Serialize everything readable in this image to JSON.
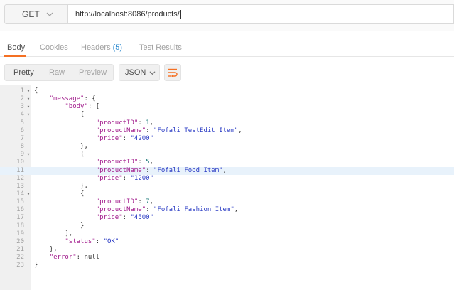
{
  "request": {
    "method": "GET",
    "url": "http://localhost:8086/products/"
  },
  "tabs": [
    {
      "label": "Body"
    },
    {
      "label": "Cookies"
    },
    {
      "label": "Headers"
    },
    {
      "label": "Test Results"
    }
  ],
  "headers_count": "(5)",
  "views": [
    {
      "label": "Pretty"
    },
    {
      "label": "Raw"
    },
    {
      "label": "Preview"
    }
  ],
  "format": "JSON",
  "colors": {
    "accent": "#f47023",
    "key": "#a11a8b",
    "string": "#2a3bc4",
    "number": "#1d7a7a",
    "highlight": "#e8f2fb"
  },
  "code": [
    {
      "n": "1",
      "fold": true,
      "tokens": [
        {
          "t": "p",
          "v": "{"
        }
      ]
    },
    {
      "n": "2",
      "fold": true,
      "tokens": [
        {
          "t": "p",
          "v": "    "
        },
        {
          "t": "k",
          "v": "\"message\""
        },
        {
          "t": "p",
          "v": ": {"
        }
      ]
    },
    {
      "n": "3",
      "fold": true,
      "tokens": [
        {
          "t": "p",
          "v": "        "
        },
        {
          "t": "k",
          "v": "\"body\""
        },
        {
          "t": "p",
          "v": ": ["
        }
      ]
    },
    {
      "n": "4",
      "fold": true,
      "tokens": [
        {
          "t": "p",
          "v": "            {"
        }
      ]
    },
    {
      "n": "5",
      "fold": false,
      "tokens": [
        {
          "t": "p",
          "v": "                "
        },
        {
          "t": "k",
          "v": "\"productID\""
        },
        {
          "t": "p",
          "v": ": "
        },
        {
          "t": "n",
          "v": "1"
        },
        {
          "t": "p",
          "v": ","
        }
      ]
    },
    {
      "n": "6",
      "fold": false,
      "tokens": [
        {
          "t": "p",
          "v": "                "
        },
        {
          "t": "k",
          "v": "\"productName\""
        },
        {
          "t": "p",
          "v": ": "
        },
        {
          "t": "s",
          "v": "\"Fofali TestEdit Item\""
        },
        {
          "t": "p",
          "v": ","
        }
      ]
    },
    {
      "n": "7",
      "fold": false,
      "tokens": [
        {
          "t": "p",
          "v": "                "
        },
        {
          "t": "k",
          "v": "\"price\""
        },
        {
          "t": "p",
          "v": ": "
        },
        {
          "t": "s",
          "v": "\"4200\""
        }
      ]
    },
    {
      "n": "8",
      "fold": false,
      "tokens": [
        {
          "t": "p",
          "v": "            },"
        }
      ]
    },
    {
      "n": "9",
      "fold": true,
      "tokens": [
        {
          "t": "p",
          "v": "            {"
        }
      ]
    },
    {
      "n": "10",
      "fold": false,
      "tokens": [
        {
          "t": "p",
          "v": "                "
        },
        {
          "t": "k",
          "v": "\"productID\""
        },
        {
          "t": "p",
          "v": ": "
        },
        {
          "t": "n",
          "v": "5"
        },
        {
          "t": "p",
          "v": ","
        }
      ]
    },
    {
      "n": "11",
      "fold": false,
      "tokens": [
        {
          "t": "p",
          "v": "                "
        },
        {
          "t": "k",
          "v": "\"productName\""
        },
        {
          "t": "p",
          "v": ": "
        },
        {
          "t": "s",
          "v": "\"Fofali Food Item\""
        },
        {
          "t": "p",
          "v": ","
        }
      ]
    },
    {
      "n": "12",
      "fold": false,
      "tokens": [
        {
          "t": "p",
          "v": "                "
        },
        {
          "t": "k",
          "v": "\"price\""
        },
        {
          "t": "p",
          "v": ": "
        },
        {
          "t": "s",
          "v": "\"1200\""
        }
      ]
    },
    {
      "n": "13",
      "fold": false,
      "tokens": [
        {
          "t": "p",
          "v": "            },"
        }
      ]
    },
    {
      "n": "14",
      "fold": true,
      "tokens": [
        {
          "t": "p",
          "v": "            {"
        }
      ]
    },
    {
      "n": "15",
      "fold": false,
      "tokens": [
        {
          "t": "p",
          "v": "                "
        },
        {
          "t": "k",
          "v": "\"productID\""
        },
        {
          "t": "p",
          "v": ": "
        },
        {
          "t": "n",
          "v": "7"
        },
        {
          "t": "p",
          "v": ","
        }
      ]
    },
    {
      "n": "16",
      "fold": false,
      "tokens": [
        {
          "t": "p",
          "v": "                "
        },
        {
          "t": "k",
          "v": "\"productName\""
        },
        {
          "t": "p",
          "v": ": "
        },
        {
          "t": "s",
          "v": "\"Fofali Fashion Item\""
        },
        {
          "t": "p",
          "v": ","
        }
      ]
    },
    {
      "n": "17",
      "fold": false,
      "tokens": [
        {
          "t": "p",
          "v": "                "
        },
        {
          "t": "k",
          "v": "\"price\""
        },
        {
          "t": "p",
          "v": ": "
        },
        {
          "t": "s",
          "v": "\"4500\""
        }
      ]
    },
    {
      "n": "18",
      "fold": false,
      "tokens": [
        {
          "t": "p",
          "v": "            }"
        }
      ]
    },
    {
      "n": "19",
      "fold": false,
      "tokens": [
        {
          "t": "p",
          "v": "        ],"
        }
      ]
    },
    {
      "n": "20",
      "fold": false,
      "tokens": [
        {
          "t": "p",
          "v": "        "
        },
        {
          "t": "k",
          "v": "\"status\""
        },
        {
          "t": "p",
          "v": ": "
        },
        {
          "t": "s",
          "v": "\"OK\""
        }
      ]
    },
    {
      "n": "21",
      "fold": false,
      "tokens": [
        {
          "t": "p",
          "v": "    },"
        }
      ]
    },
    {
      "n": "22",
      "fold": false,
      "tokens": [
        {
          "t": "p",
          "v": "    "
        },
        {
          "t": "k",
          "v": "\"error\""
        },
        {
          "t": "p",
          "v": ": null"
        }
      ]
    },
    {
      "n": "23",
      "fold": false,
      "tokens": [
        {
          "t": "p",
          "v": "}"
        }
      ]
    }
  ],
  "highlighted_line": "11"
}
